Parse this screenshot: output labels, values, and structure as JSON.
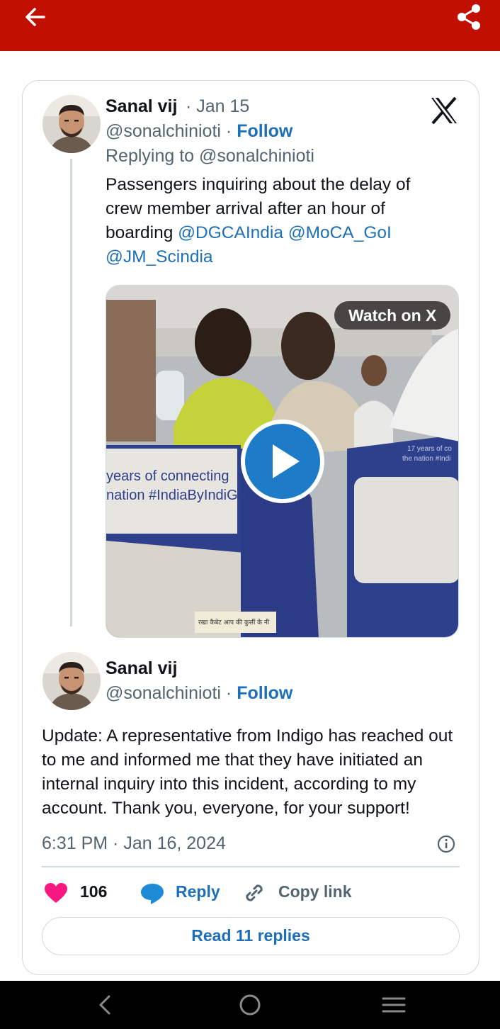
{
  "header": {
    "background": "#c10f00"
  },
  "tweet1": {
    "author_name": "Sanal vij",
    "date": "· Jan 15",
    "handle": "@sonalchinioti",
    "separator": "·",
    "follow_label": "Follow",
    "replying_to": "Replying to @sonalchinioti",
    "text": "Passengers inquiring about the delay of crew member arrival after an hour of boarding",
    "mentions": [
      "@DGCAIndia",
      "@MoCA_GoI",
      "@JM_Scindia"
    ],
    "media": {
      "watch_label": "Watch on X",
      "seat_text_left": "years of connecting",
      "seat_text_left2": "nation #IndiaByIndiGo",
      "seat_text_right": "17 years of co",
      "seat_text_right2": "the nation #Indi",
      "tray_text": "रखा कैबेट आप की कुर्सी के नी"
    }
  },
  "tweet2": {
    "author_name": "Sanal vij",
    "handle": "@sonalchinioti",
    "separator": "·",
    "follow_label": "Follow",
    "text": "Update: A representative from Indigo has reached out to me and informed me that they have initiated an internal inquiry into this incident, according to my account. Thank you, everyone, for your support!",
    "timestamp": "6:31 PM · Jan 16, 2024"
  },
  "actions": {
    "like_count": "106",
    "reply_label": "Reply",
    "copy_label": "Copy link",
    "read_replies_label": "Read 11 replies"
  },
  "colors": {
    "accent": "#1d6fb8",
    "like": "#f91880",
    "border": "#cfd9de"
  }
}
